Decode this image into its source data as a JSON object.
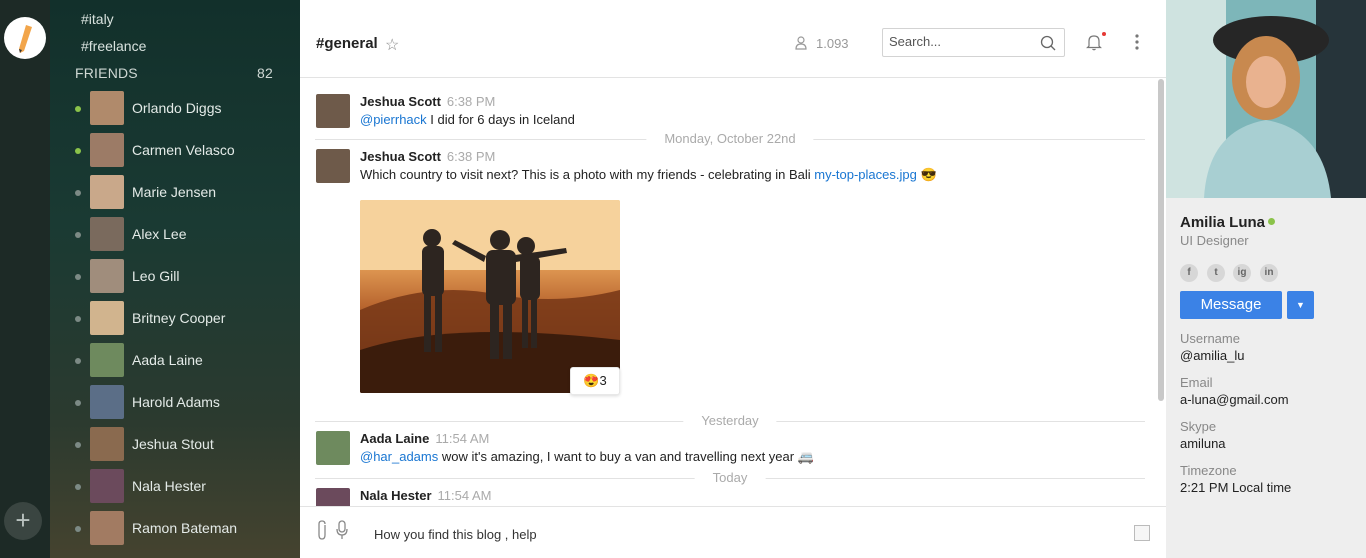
{
  "sidebar": {
    "channels": [
      "#italy",
      "#freelance"
    ],
    "friends_title": "FRIENDS",
    "friends_count": "82",
    "friends": [
      {
        "name": "Orlando Diggs",
        "online": true,
        "avatar_color": "#b08a6b"
      },
      {
        "name": "Carmen Velasco",
        "online": true,
        "avatar_color": "#9c7b66"
      },
      {
        "name": "Marie Jensen",
        "online": false,
        "avatar_color": "#c9a88a"
      },
      {
        "name": "Alex Lee",
        "online": false,
        "avatar_color": "#7a6a5d"
      },
      {
        "name": "Leo Gill",
        "online": false,
        "avatar_color": "#a08d7c"
      },
      {
        "name": "Britney Cooper",
        "online": false,
        "avatar_color": "#d1b48e"
      },
      {
        "name": "Aada Laine",
        "online": false,
        "avatar_color": "#6e8a5e"
      },
      {
        "name": "Harold Adams",
        "online": false,
        "avatar_color": "#5b6e87"
      },
      {
        "name": "Jeshua Stout",
        "online": false,
        "avatar_color": "#8a6a4f"
      },
      {
        "name": "Nala Hester",
        "online": false,
        "avatar_color": "#6b4a5c"
      },
      {
        "name": "Ramon Bateman",
        "online": false,
        "avatar_color": "#a27b62"
      }
    ]
  },
  "header": {
    "channel": "#general",
    "user_count": "1.093",
    "search_placeholder": "Search..."
  },
  "messages": [
    {
      "author": "Jeshua Scott",
      "time": "6:38 PM",
      "mention": "@pierrhack",
      "text": " I did for 6 days in Iceland",
      "avatar_color": "#6e5a4a"
    },
    {
      "author": "Jeshua Scott",
      "time": "6:38 PM",
      "text": "Which country to visit next? This is a photo with my friends - celebrating in Bali ",
      "link": "my-top-places.jpg",
      "emoji": "😎",
      "avatar_color": "#6e5a4a"
    },
    {
      "author": "Aada Laine",
      "time": "11:54 AM",
      "mention": "@har_adams",
      "text": " wow it's amazing, I want to buy a van and travelling next year ",
      "emoji": "🚐",
      "avatar_color": "#6e8a5e"
    },
    {
      "author": "Nala Hester",
      "time": "11:54 AM",
      "avatar_color": "#6b4a5c"
    }
  ],
  "dividers": [
    "Monday, October 22nd",
    "Yesterday",
    "Today"
  ],
  "reaction": {
    "emoji": "😍",
    "count": "3"
  },
  "composer": {
    "text": "How you find this blog , help"
  },
  "profile": {
    "name": "Amilia Luna",
    "title": "UI Designer",
    "social": [
      "f",
      "t",
      "ig",
      "in"
    ],
    "message_button": "Message",
    "fields": [
      {
        "label": "Username",
        "value": "@amilia_lu"
      },
      {
        "label": "Email",
        "value": "a-luna@gmail.com"
      },
      {
        "label": "Skype",
        "value": "amiluna"
      },
      {
        "label": "Timezone",
        "value": "2:21 PM Local time"
      }
    ]
  },
  "colors": {
    "accent": "#3b82e6",
    "online": "#8bc34a",
    "link": "#1976d2"
  }
}
